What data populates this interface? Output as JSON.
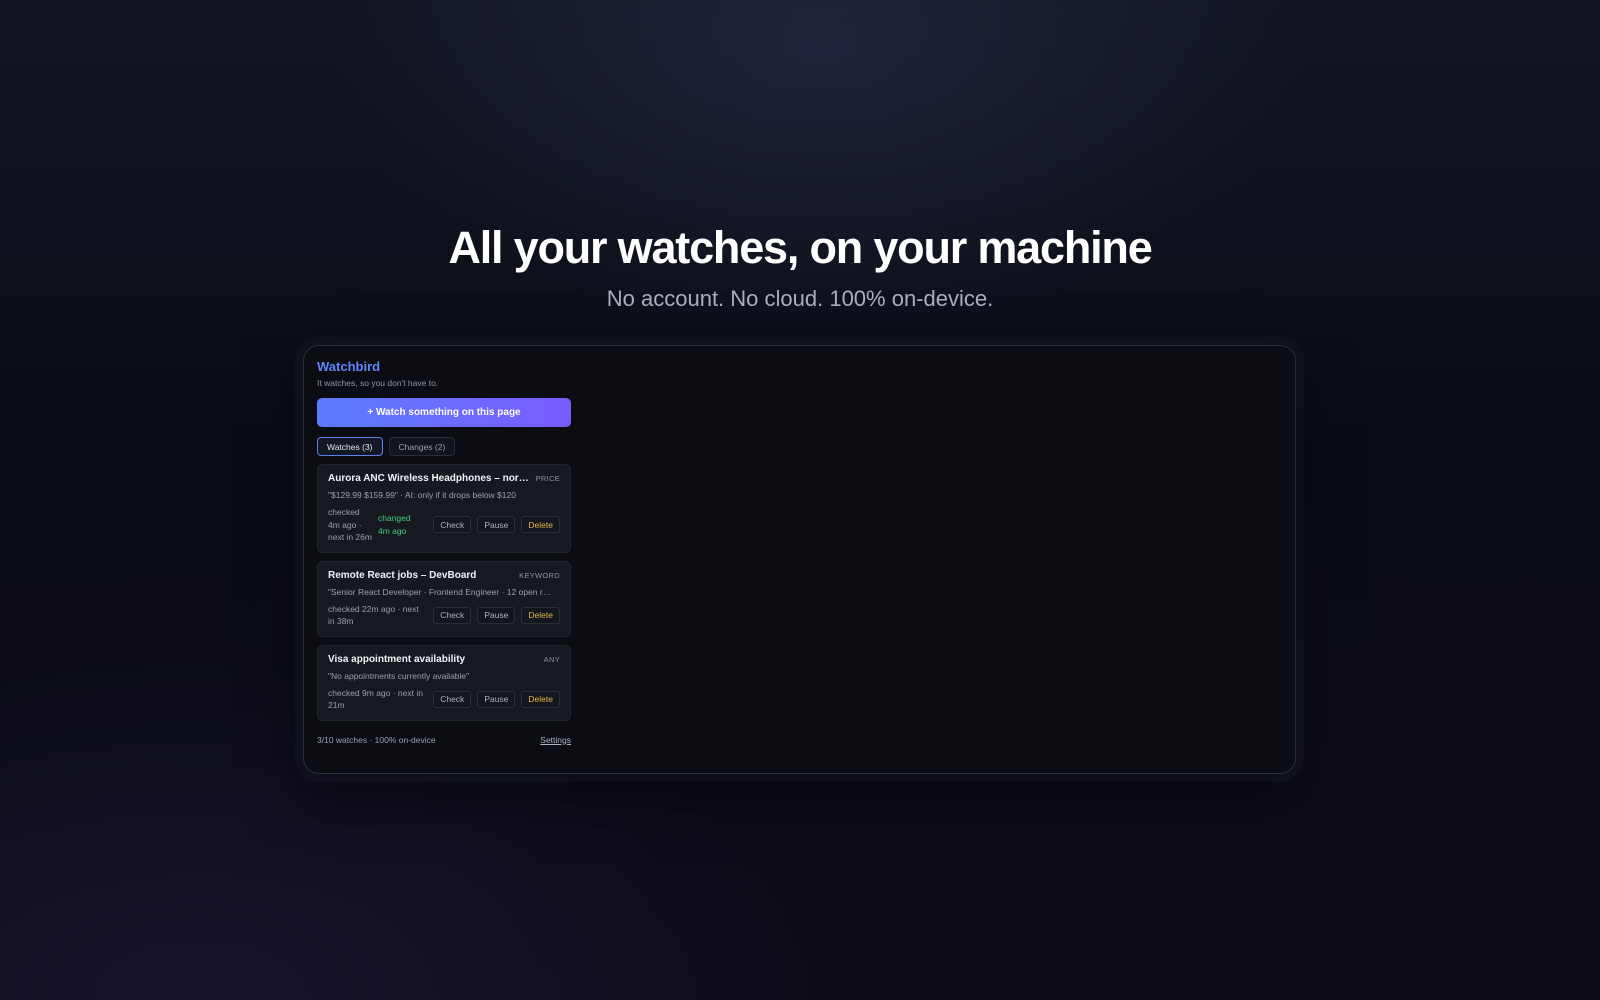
{
  "hero": {
    "title": "All your watches, on your machine",
    "subtitle": "No account. No cloud. 100% on-device."
  },
  "panel": {
    "brand": "Watchbird",
    "tagline": "It watches, so you don't have to.",
    "watch_button": "+ Watch something on this page",
    "tabs": [
      {
        "label": "Watches (3)",
        "active": true
      },
      {
        "label": "Changes (2)",
        "active": false
      }
    ],
    "watches": [
      {
        "title": "Aurora ANC Wireless Headphones – nor…",
        "kind": "PRICE",
        "snippet": "\"$129.99 $159.99\" · AI: only if it drops below $120",
        "meta": "checked 4m ago · next in 26m",
        "changed": "changed 4m ago",
        "check": "Check",
        "pause": "Pause",
        "delete": "Delete"
      },
      {
        "title": "Remote React jobs – DevBoard",
        "kind": "KEYWORD",
        "snippet": "\"Senior React Developer · Frontend Engineer · 12 open r…",
        "meta": "checked 22m ago · next in 38m",
        "check": "Check",
        "pause": "Pause",
        "delete": "Delete"
      },
      {
        "title": "Visa appointment availability",
        "kind": "ANY",
        "snippet": "\"No appointments currently available\"",
        "meta": "checked 9m ago · next in 21m",
        "check": "Check",
        "pause": "Pause",
        "delete": "Delete"
      }
    ],
    "footer": {
      "status": "3/10 watches · 100% on-device",
      "settings": "Settings"
    }
  },
  "colors": {
    "brand": "#5f86ff",
    "button_gradient_start": "#5b7cff",
    "button_gradient_end": "#7a5cff",
    "changed": "#3fcf7a",
    "delete": "#e6b84a"
  }
}
